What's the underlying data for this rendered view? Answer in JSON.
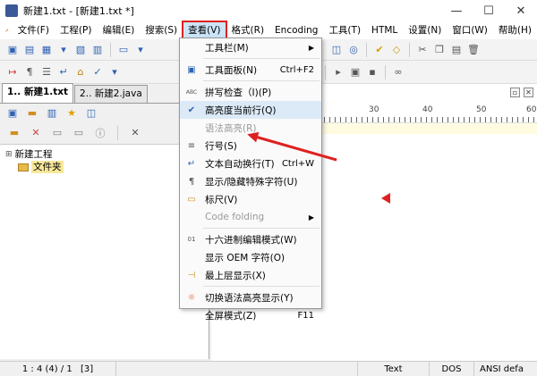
{
  "titlebar": {
    "title": "新建1.txt - [新建1.txt *]",
    "min": "—",
    "max": "☐",
    "close": "✕"
  },
  "menubar": {
    "items": [
      {
        "label": "文件(F)"
      },
      {
        "label": "工程(P)"
      },
      {
        "label": "编辑(E)"
      },
      {
        "label": "搜索(S)"
      },
      {
        "label": "查看(V)"
      },
      {
        "label": "格式(R)"
      },
      {
        "label": "Encoding"
      },
      {
        "label": "工具(T)"
      },
      {
        "label": "HTML"
      },
      {
        "label": "设置(N)"
      },
      {
        "label": "窗口(W)"
      },
      {
        "label": "帮助(H)"
      }
    ]
  },
  "tabs": {
    "items": [
      {
        "label": "1.. 新建1.txt"
      },
      {
        "label": "2.. 新建2.java"
      }
    ]
  },
  "tree": {
    "root": "新建工程",
    "child": "文件夹"
  },
  "ruler": {
    "labels": [
      "30",
      "40",
      "50",
      "60"
    ]
  },
  "view_menu": {
    "items": [
      {
        "label": "工具栏(M)",
        "shortcut": "",
        "icon": "",
        "submenu": true
      },
      {
        "label": "工具面板(N)",
        "shortcut": "Ctrl+F2",
        "icon": "▣",
        "submenu": false
      },
      {
        "label": "拼写检查（I)(P)",
        "shortcut": "",
        "icon": "ABC",
        "submenu": false
      },
      {
        "label": "高亮度当前行(Q)",
        "shortcut": "",
        "icon": "✔",
        "submenu": false
      },
      {
        "label": "语法高亮(R)",
        "shortcut": "",
        "icon": "",
        "submenu": false
      },
      {
        "label": "行号(S)",
        "shortcut": "",
        "icon": "≡",
        "submenu": false
      },
      {
        "label": "文本自动换行(T)",
        "shortcut": "Ctrl+W",
        "icon": "↵",
        "submenu": false
      },
      {
        "label": "显示/隐藏特殊字符(U)",
        "shortcut": "",
        "icon": "¶",
        "submenu": false
      },
      {
        "label": "标尺(V)",
        "shortcut": "",
        "icon": "▭",
        "submenu": false
      },
      {
        "label": "Code folding",
        "shortcut": "",
        "icon": "",
        "submenu": true
      },
      {
        "label": "十六进制编辑模式(W)",
        "shortcut": "",
        "icon": "01",
        "submenu": false
      },
      {
        "label": "显示 OEM 字符(O)",
        "shortcut": "",
        "icon": "",
        "submenu": false
      },
      {
        "label": "最上层显示(X)",
        "shortcut": "",
        "icon": "⊣",
        "submenu": false
      },
      {
        "label": "切换语法高亮显示(Y)",
        "shortcut": "",
        "icon": "☼",
        "submenu": false
      },
      {
        "label": "全屏模式(Z)",
        "shortcut": "F11",
        "icon": "",
        "submenu": false
      }
    ]
  },
  "statusbar": {
    "position": "1 : 4 (4) / 1",
    "selection": "[3]",
    "mode": "Text",
    "eol": "DOS",
    "encoding": "ANSI defa"
  },
  "colors": {
    "highlight_outline": "#e02020",
    "menu_selected": "#cce4f7",
    "checked_item": "#dceaf7",
    "folder": "#e8b84a"
  }
}
